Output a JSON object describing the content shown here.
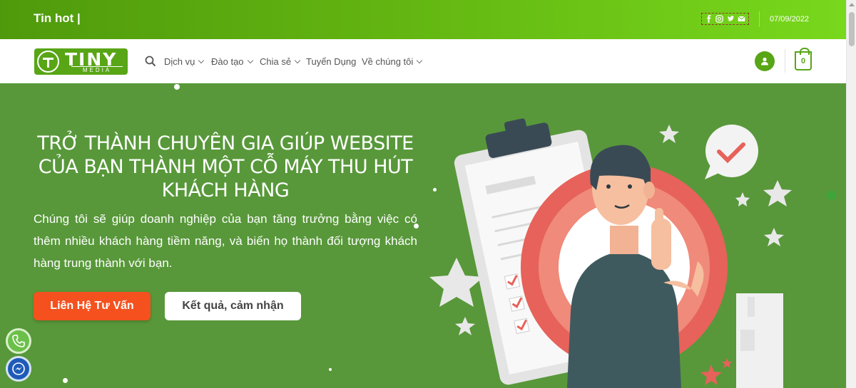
{
  "topbar": {
    "tinhot": "Tin hot |",
    "date": "07/09/2022",
    "socials": [
      "facebook-icon",
      "instagram-icon",
      "twitter-icon",
      "mail-icon"
    ]
  },
  "nav": {
    "items": [
      {
        "label": "Dịch vụ",
        "dropdown": true
      },
      {
        "label": "Đào tạo",
        "dropdown": true
      },
      {
        "label": "Chia sẻ",
        "dropdown": true
      },
      {
        "label": "Tuyển Dụng",
        "dropdown": false
      },
      {
        "label": "Về chúng tôi",
        "dropdown": true
      }
    ],
    "cart_count": "0"
  },
  "logo": {
    "brand": "TINY",
    "sub": "MEDIA"
  },
  "hero": {
    "title_lines": [
      "TRỞ THÀNH CHUYÊN GIA GIÚP WEBSITE",
      "CỦA BẠN THÀNH MỘT CỖ MÁY THU HÚT",
      "KHÁCH HÀNG"
    ],
    "description": "Chúng tôi sẽ giúp doanh nghiệp của bạn tăng trưởng bằng việc có thêm nhiều khách hàng tiềm năng, và biến họ thành đối tượng khách hàng trung thành với bạn.",
    "primary_button": "Liên Hệ Tư Vấn",
    "secondary_button": "Kết quả, cảm nhận"
  },
  "colors": {
    "brand_green": "#58a516",
    "hero_bg": "#58983a",
    "cta_orange": "#f4511e"
  }
}
